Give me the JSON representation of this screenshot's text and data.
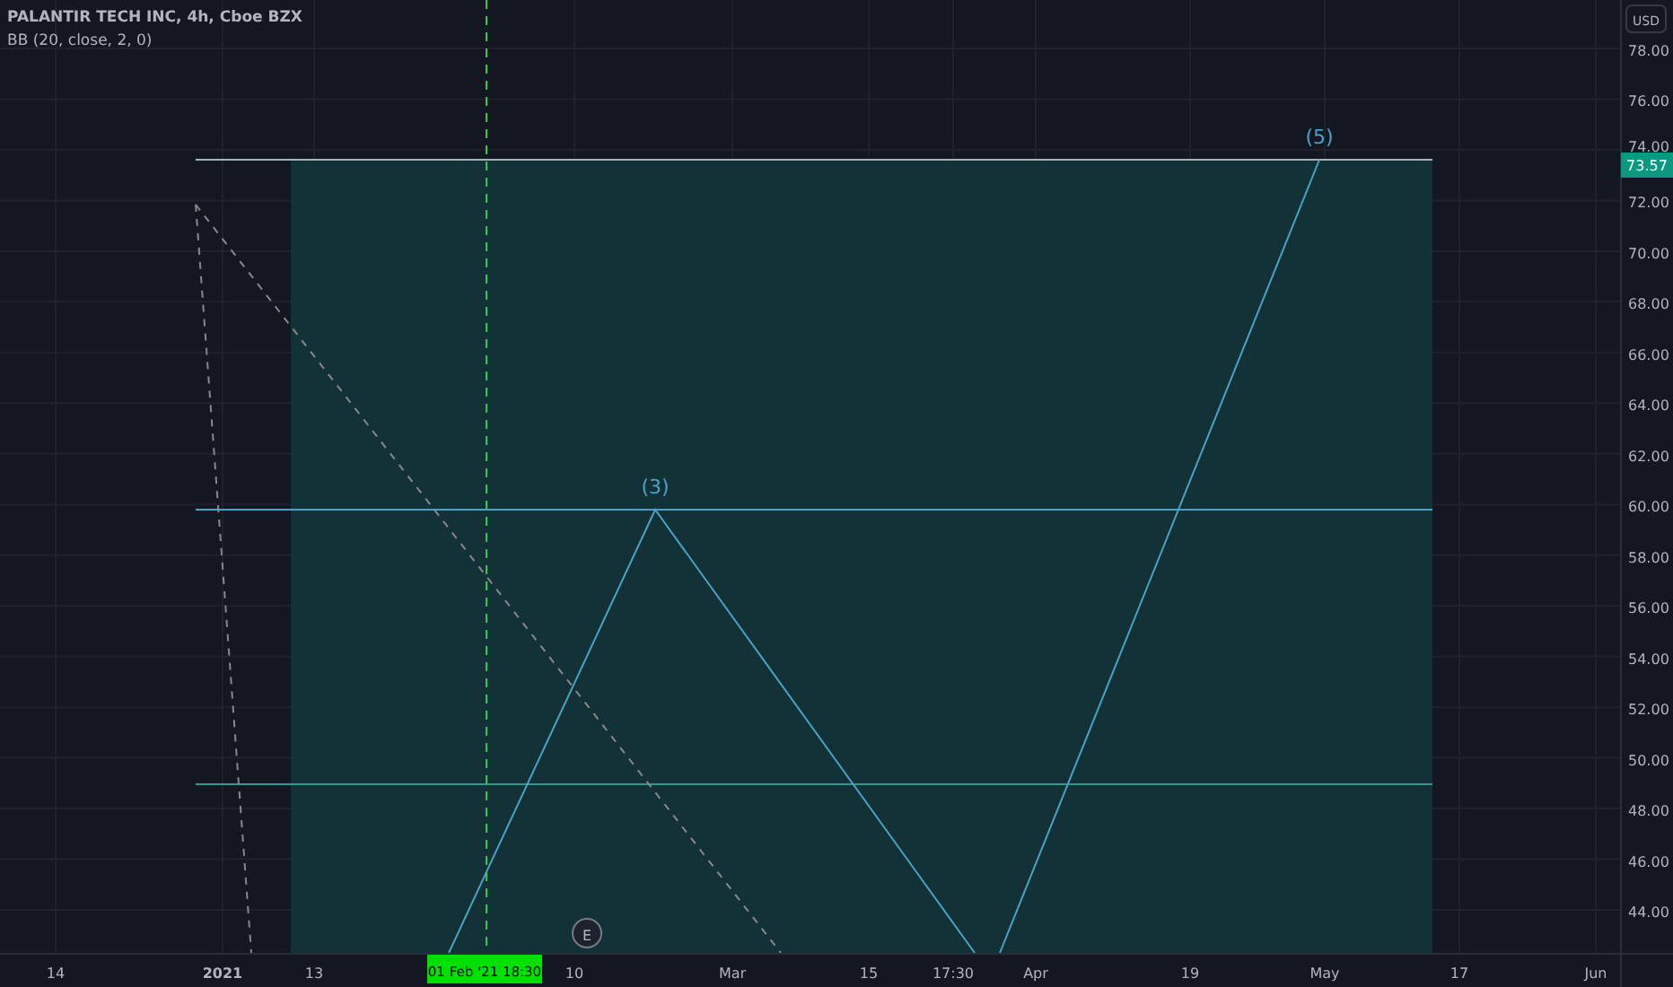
{
  "legend": {
    "title": "PALANTIR TECH INC, 4h, Cboe BZX",
    "indicator": "BB (20, close, 2, 0)"
  },
  "price_axis": {
    "currency": "USD",
    "ticks": [
      "78.00",
      "76.00",
      "74.00",
      "72.00",
      "70.00",
      "68.00",
      "66.00",
      "64.00",
      "62.00",
      "60.00",
      "58.00",
      "56.00",
      "54.00",
      "52.00",
      "50.00",
      "48.00",
      "46.00",
      "44.00"
    ],
    "current_price": "73.57"
  },
  "time_axis": {
    "labels": [
      "14",
      "2021",
      "13",
      "10",
      "Mar",
      "15",
      "17:30",
      "Apr",
      "19",
      "May",
      "17",
      "Jun"
    ],
    "crosshair_label": "01 Feb '21   18:30"
  },
  "wave_labels": [
    "(3)",
    "(5)"
  ],
  "earnings_marker": "E"
}
